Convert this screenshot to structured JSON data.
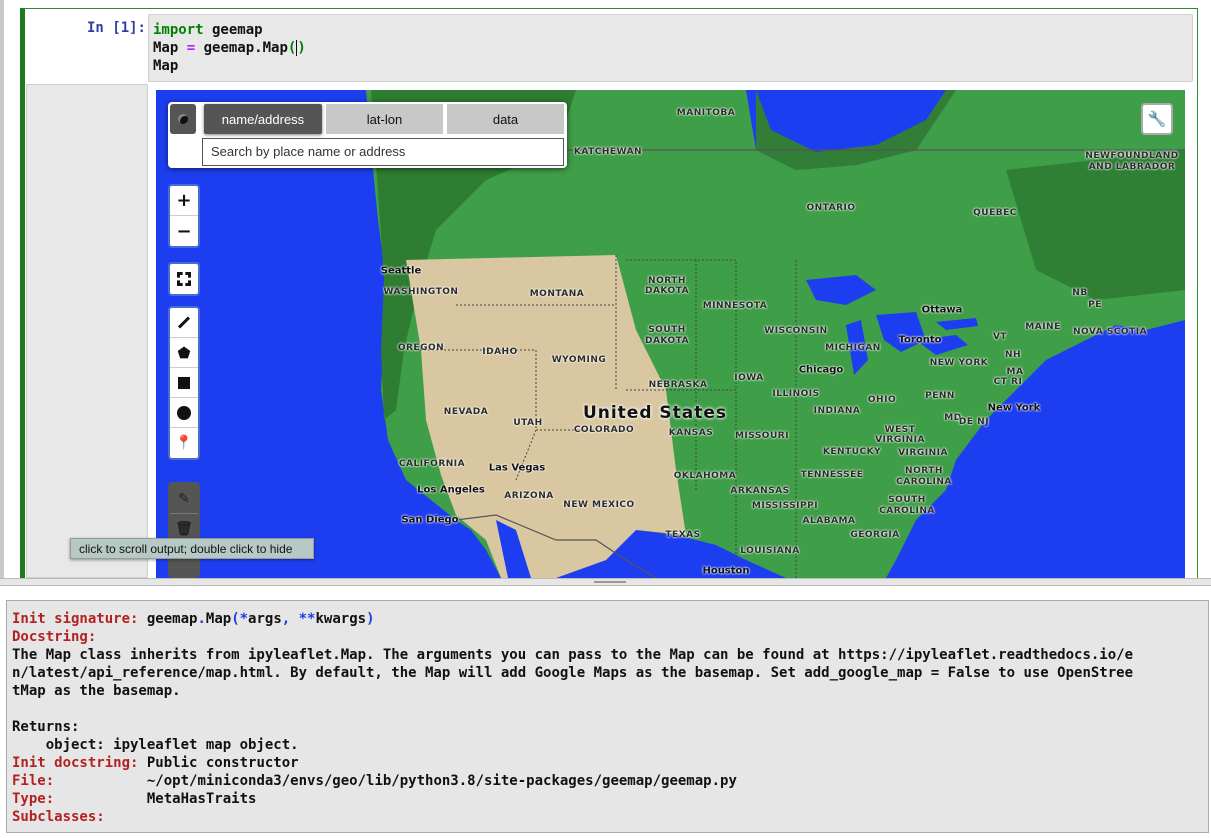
{
  "cell": {
    "prompt": "In [1]:",
    "code": {
      "line1_kw": "import",
      "line1_rest": " geemap",
      "line2_a": "Map ",
      "line2_op": "=",
      "line2_b": " geemap.Map",
      "line2_paren_open": "(",
      "line2_paren_close": ")",
      "line3": "Map"
    }
  },
  "map": {
    "colors": {
      "ocean": "#1d3ef0",
      "land": "#3f9e48",
      "forest": "#2e7d32",
      "desert": "#d8c7a0"
    },
    "search": {
      "globe_icon": "globe-icon",
      "tabs": [
        "name/address",
        "lat-lon",
        "data"
      ],
      "active_tab": "name/address",
      "placeholder": "Search by place name or address"
    },
    "zoom_in": "+",
    "zoom_out": "−",
    "labels": [
      "MANITOBA",
      "KATCHEWAN",
      "NEWFOUNDLAND",
      "AND LABRADOR",
      "ONTARIO",
      "QUEBEC",
      "Seattle",
      "WASHINGTON",
      "MONTANA",
      "NORTH",
      "DAKOTA",
      "MINNESOTA",
      "SOUTH",
      "DAKOTA",
      "OREGON",
      "IDAHO",
      "WYOMING",
      "WISCONSIN",
      "MICHIGAN",
      "Ottawa",
      "Toronto",
      "NB",
      "PE",
      "MAINE",
      "NOVA SCOTIA",
      "VT",
      "NH",
      "NEW YORK",
      "MA",
      "CT RI",
      "Chicago",
      "IOWA",
      "NEBRASKA",
      "ILLINOIS",
      "OHIO",
      "PENN",
      "New York",
      "NEVADA",
      "UTAH",
      "United States",
      "COLORADO",
      "KANSAS",
      "INDIANA",
      "MD",
      "DE NJ",
      "MISSOURI",
      "WEST",
      "VIRGINIA",
      "KENTUCKY",
      "VIRGINIA",
      "CALIFORNIA",
      "Las Vegas",
      "OKLAHOMA",
      "TENNESSEE",
      "NORTH",
      "CAROLINA",
      "Los Angeles",
      "ARIZONA",
      "ARKANSAS",
      "MISSISSIPPI",
      "SOUTH",
      "CAROLINA",
      "NEW MEXICO",
      "San Diego",
      "ALABAMA",
      "GEORGIA",
      "TEXAS",
      "LOUISIANA",
      "Houston"
    ]
  },
  "tooltip": "click to scroll output; double click to hide",
  "pager": {
    "sig_label": "Init signature:",
    "sig_a": " geemap",
    "sig_dot": ".",
    "sig_b": "Map",
    "sig_p1": "(*",
    "sig_args": "args",
    "sig_p2": ", **",
    "sig_kwargs": "kwargs",
    "sig_p3": ")",
    "doc_label": "Docstring:",
    "doc_lines": [
      "The Map class inherits from ipyleaflet.Map. The arguments you can pass to the Map can be found at https://ipyleaflet.readthedocs.io/e",
      "n/latest/api_reference/map.html. By default, the Map will add Google Maps as the basemap. Set add_google_map = False to use OpenStree",
      "tMap as the basemap."
    ],
    "returns": "Returns:",
    "returns_line": "    object: ipyleaflet map object.",
    "init_doc_label": "Init docstring:",
    "init_doc": " Public constructor",
    "file_label": "File:",
    "file": "           ~/opt/miniconda3/envs/geo/lib/python3.8/site-packages/geemap/geemap.py",
    "type_label": "Type:",
    "type": "           MetaHasTraits",
    "subclasses_label": "Subclasses:"
  }
}
